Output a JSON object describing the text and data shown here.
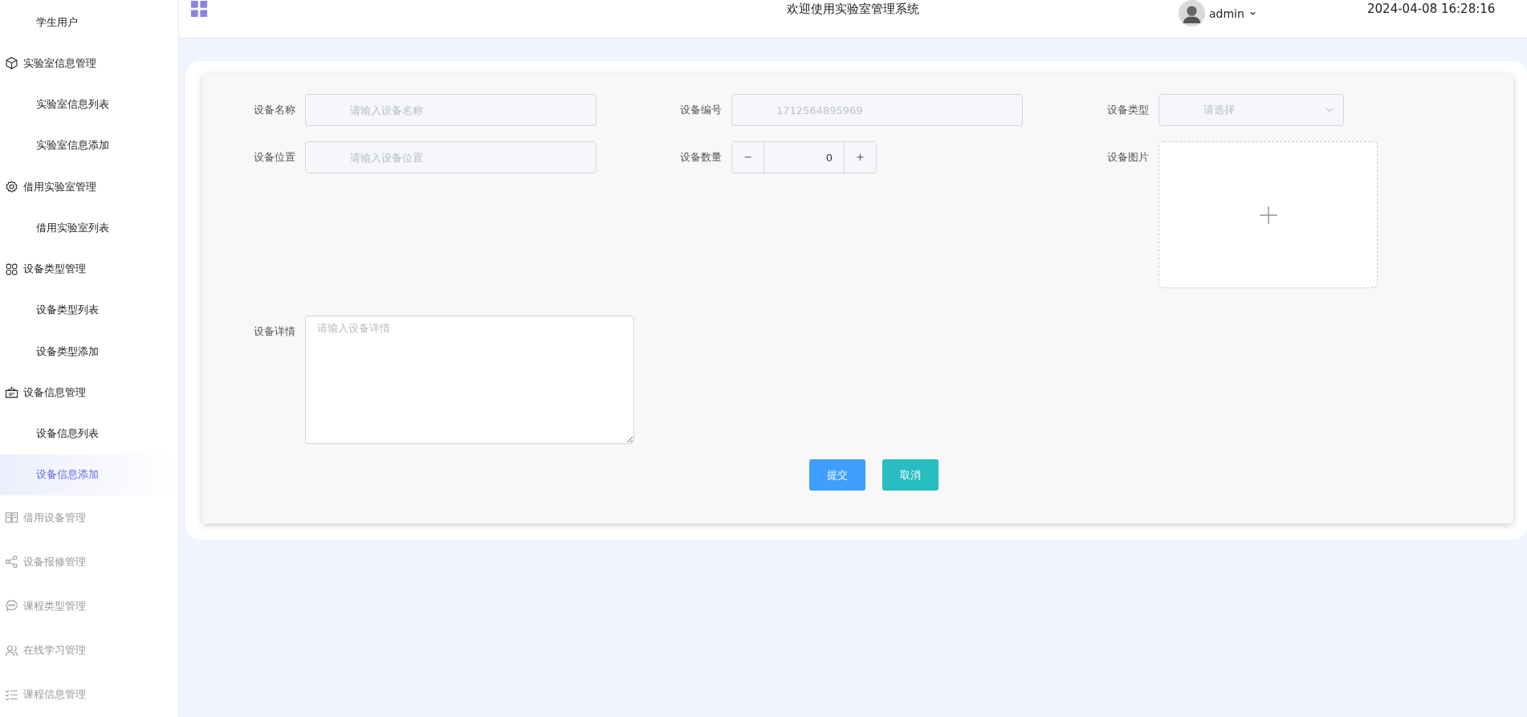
{
  "sidebar": {
    "items": [
      {
        "kind": "sub",
        "label": "学生用户",
        "selected": false
      },
      {
        "kind": "group",
        "label": "实验室信息管理",
        "expanded": true,
        "children": [
          {
            "label": "实验室信息列表",
            "selected": false
          },
          {
            "label": "实验室信息添加",
            "selected": false
          }
        ]
      },
      {
        "kind": "group",
        "label": "借用实验室管理",
        "expanded": true,
        "children": [
          {
            "label": "借用实验室列表",
            "selected": false
          }
        ]
      },
      {
        "kind": "group",
        "label": "设备类型管理",
        "expanded": true,
        "children": [
          {
            "label": "设备类型列表",
            "selected": false
          },
          {
            "label": "设备类型添加",
            "selected": false
          }
        ]
      },
      {
        "kind": "group",
        "label": "设备信息管理",
        "expanded": true,
        "children": [
          {
            "label": "设备信息列表",
            "selected": false
          },
          {
            "label": "设备信息添加",
            "selected": true
          }
        ]
      },
      {
        "kind": "group",
        "label": "借用设备管理",
        "expanded": false
      },
      {
        "kind": "group",
        "label": "设备报修管理",
        "expanded": false
      },
      {
        "kind": "group",
        "label": "课程类型管理",
        "expanded": false
      },
      {
        "kind": "group",
        "label": "在线学习管理",
        "expanded": false
      },
      {
        "kind": "group",
        "label": "课程信息管理",
        "expanded": false
      }
    ]
  },
  "header": {
    "title": "欢迎使用实验室管理系统",
    "user": "admin",
    "datetime": "2024-04-08 16:28:16"
  },
  "form": {
    "fields": [
      {
        "kind": "text",
        "label": "设备名称",
        "placeholder": "请输入设备名称"
      },
      {
        "kind": "text",
        "label": "设备编号",
        "value": "1712564895969",
        "disabled": true
      },
      {
        "kind": "select",
        "label": "设备类型",
        "placeholder": "请选择"
      },
      {
        "kind": "text",
        "label": "设备位置",
        "placeholder": "请输入设备位置"
      },
      {
        "kind": "number",
        "label": "设备数量",
        "value": "0",
        "minus": "−",
        "plus": "+"
      },
      {
        "kind": "upload",
        "label": "设备图片"
      },
      {
        "kind": "textarea",
        "label": "设备详情",
        "placeholder": "请输入设备详情"
      }
    ],
    "buttons": [
      {
        "label": "提交",
        "kind": "primary"
      },
      {
        "label": "取消",
        "kind": "secondary"
      }
    ]
  }
}
